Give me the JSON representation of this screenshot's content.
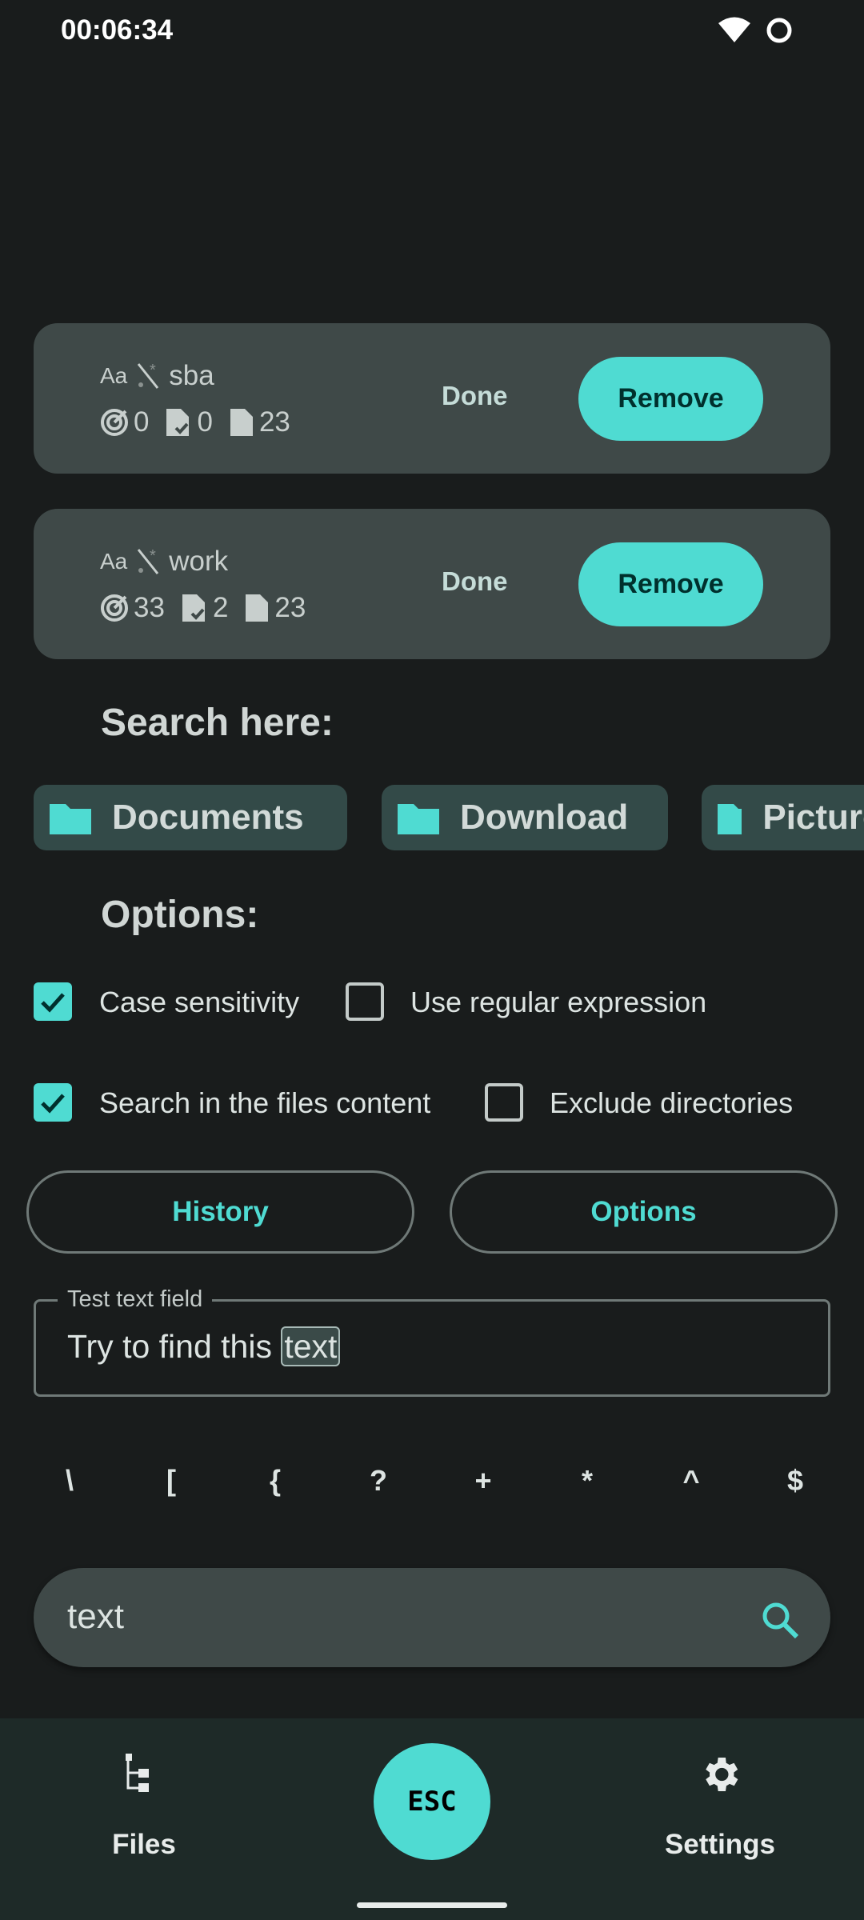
{
  "status_bar": {
    "time": "00:06:34",
    "icons": [
      "wifi-icon",
      "loading-ring-icon"
    ]
  },
  "searches": [
    {
      "query": "sba",
      "case_icon": "Aa",
      "regex_off_icon": "regex-off-icon",
      "matches": "0",
      "files_matched": "0",
      "files_total": "23",
      "done_label": "Done",
      "remove_label": "Remove"
    },
    {
      "query": "work",
      "case_icon": "Aa",
      "regex_off_icon": "regex-off-icon",
      "matches": "33",
      "files_matched": "2",
      "files_total": "23",
      "done_label": "Done",
      "remove_label": "Remove"
    }
  ],
  "search_here": {
    "title": "Search here:",
    "folders": [
      "Documents",
      "Download",
      "Pictures"
    ]
  },
  "options": {
    "title": "Options:",
    "checkboxes": [
      {
        "label": "Case sensitivity",
        "checked": true
      },
      {
        "label": "Use regular expression",
        "checked": false
      },
      {
        "label": "Search in the files content",
        "checked": true
      },
      {
        "label": "Exclude directories",
        "checked": false
      }
    ],
    "history_label": "History",
    "options_label": "Options"
  },
  "test_field": {
    "label": "Test text field",
    "text_before": "Try to find this ",
    "highlight": "text"
  },
  "symbols": [
    "\\",
    "[",
    "{",
    "?",
    "+",
    "*",
    "^",
    "$"
  ],
  "search_bar": {
    "value": "text"
  },
  "bottom_nav": {
    "files": "Files",
    "esc": "ESC",
    "settings": "Settings"
  },
  "colors": {
    "accent": "#4fdbd2",
    "background": "#191c1c",
    "card": "#3f4948"
  }
}
